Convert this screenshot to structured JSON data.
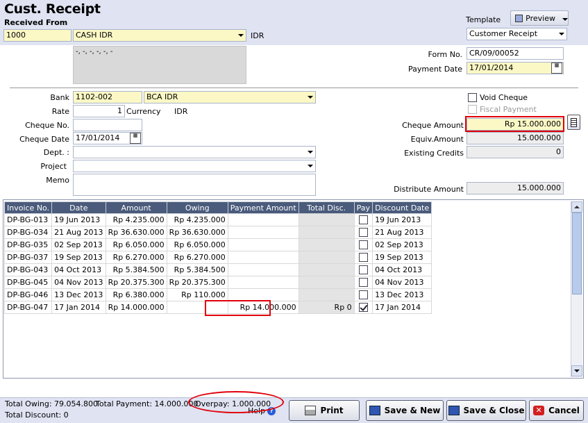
{
  "form": {
    "title": "Cust. Receipt",
    "received_from_label": "Received From",
    "customer_code": "1000",
    "customer_name": "CASH IDR",
    "currency": "IDR",
    "address_text": "-, -, -, -, -, -",
    "template_label": "Template",
    "template_value": "Customer Receipt",
    "preview_label": "Preview",
    "form_no_label": "Form No.",
    "form_no": "CR/09/00052",
    "payment_date_label": "Payment Date",
    "payment_date": "17/01/2014"
  },
  "bank": {
    "bank_label": "Bank",
    "bank_code": "1102-002",
    "bank_name": "BCA IDR",
    "rate_label": "Rate",
    "rate": "1",
    "currency_label": "Currency",
    "currency": "IDR",
    "cheque_no_label": "Cheque No.",
    "cheque_no": "",
    "cheque_date_label": "Cheque Date",
    "cheque_date": "17/01/2014",
    "dept_label": "Dept. :",
    "project_label": "Project",
    "memo_label": "Memo"
  },
  "right_panel": {
    "void_cheque_label": "Void Cheque",
    "fiscal_payment_label": "Fiscal Payment",
    "cheque_amount_label": "Cheque Amount",
    "cheque_amount": "Rp 15.000.000",
    "equiv_amount_label": "Equiv.Amount",
    "equiv_amount": "15.000.000",
    "existing_credits_label": "Existing Credits",
    "existing_credits": "0",
    "distribute_amount_label": "Distribute Amount",
    "distribute_amount": "15.000.000"
  },
  "table": {
    "headers": [
      "Invoice No.",
      "Date",
      "Amount",
      "Owing",
      "Payment Amount",
      "Total Disc.",
      "Pay",
      "Discount Date"
    ],
    "rows": [
      {
        "invoice": "DP-BG-013",
        "date": "19 Jun 2013",
        "amount": "Rp 4.235.000",
        "owing": "Rp 4.235.000",
        "payment": "",
        "disc": "",
        "pay": false,
        "disc_date": "19 Jun 2013"
      },
      {
        "invoice": "DP-BG-034",
        "date": "21 Aug 2013",
        "amount": "Rp 36.630.000",
        "owing": "Rp 36.630.000",
        "payment": "",
        "disc": "",
        "pay": false,
        "disc_date": "21 Aug 2013"
      },
      {
        "invoice": "DP-BG-035",
        "date": "02 Sep 2013",
        "amount": "Rp 6.050.000",
        "owing": "Rp 6.050.000",
        "payment": "",
        "disc": "",
        "pay": false,
        "disc_date": "02 Sep 2013"
      },
      {
        "invoice": "DP-BG-037",
        "date": "19 Sep 2013",
        "amount": "Rp 6.270.000",
        "owing": "Rp 6.270.000",
        "payment": "",
        "disc": "",
        "pay": false,
        "disc_date": "19 Sep 2013"
      },
      {
        "invoice": "DP-BG-043",
        "date": "04 Oct 2013",
        "amount": "Rp 5.384.500",
        "owing": "Rp 5.384.500",
        "payment": "",
        "disc": "",
        "pay": false,
        "disc_date": "04 Oct 2013"
      },
      {
        "invoice": "DP-BG-045",
        "date": "04 Nov 2013",
        "amount": "Rp 20.375.300",
        "owing": "Rp 20.375.300",
        "payment": "",
        "disc": "",
        "pay": false,
        "disc_date": "04 Nov 2013"
      },
      {
        "invoice": "DP-BG-046",
        "date": "13 Dec 2013",
        "amount": "Rp 6.380.000",
        "owing": "Rp 110.000",
        "payment": "",
        "disc": "",
        "pay": false,
        "disc_date": "13 Dec 2013"
      },
      {
        "invoice": "DP-BG-047",
        "date": "17 Jan 2014",
        "amount": "Rp 14.000.000",
        "owing": "",
        "payment": "Rp 14.000.000",
        "disc": "Rp 0",
        "pay": true,
        "disc_date": "17 Jan 2014"
      }
    ]
  },
  "footer": {
    "total_owing": "Total Owing: 79.054.800",
    "total_payment": "Total Payment: 14.000.000",
    "overpay": "Overpay: 1.000.000",
    "total_discount": "Total Discount: 0",
    "help": "Help",
    "print": "Print",
    "save_new": "Save & New",
    "save_close": "Save & Close",
    "cancel": "Cancel"
  },
  "colors": {
    "header_bg": "#dfe3f2",
    "grid_header_bg": "#4a5b7b",
    "highlight_red": "#e0000a",
    "yellow_field": "#fbf8c5"
  }
}
